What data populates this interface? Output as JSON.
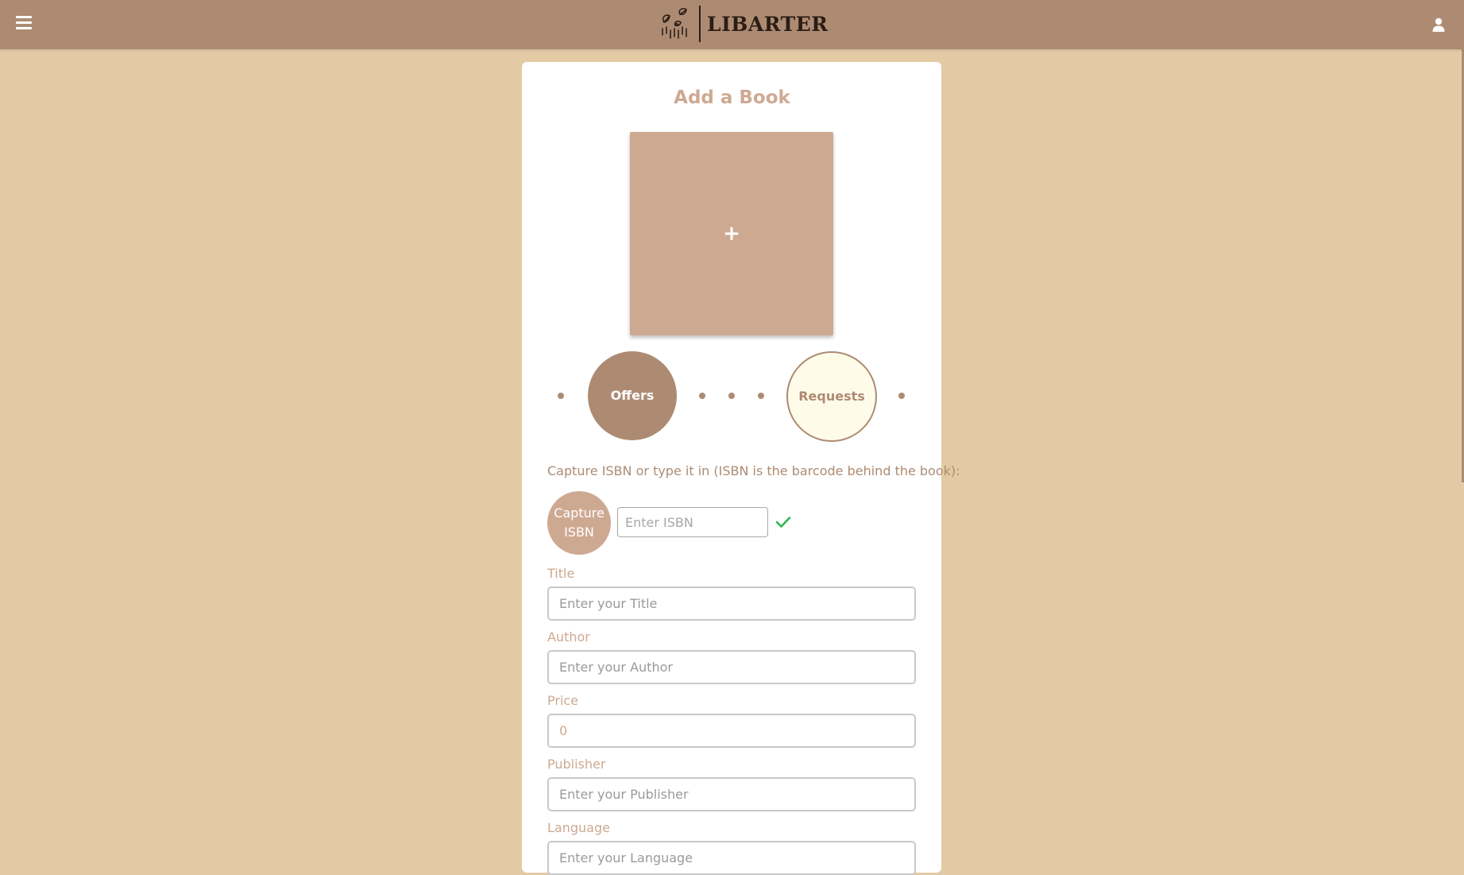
{
  "header": {
    "brand_name": "LIBARTER",
    "menu_icon": "hamburger-menu-icon",
    "user_icon": "user-icon"
  },
  "page": {
    "title": "Add a Book",
    "upload_symbol": "+"
  },
  "mode_toggle": {
    "offers_label": "Offers",
    "requests_label": "Requests",
    "selected": "Offers"
  },
  "isbn": {
    "hint": "Capture ISBN or type it in (ISBN is the barcode behind the book):",
    "capture_label_line1": "Capture",
    "capture_label_line2": "ISBN",
    "placeholder": "Enter ISBN",
    "status_icon": "checkmark-icon"
  },
  "form": {
    "title_label": "Title",
    "title_placeholder": "Enter your Title",
    "author_label": "Author",
    "author_placeholder": "Enter your Author",
    "price_label": "Price",
    "price_placeholder": "0",
    "publisher_label": "Publisher",
    "publisher_placeholder": "Enter your Publisher",
    "language_label": "Language",
    "language_placeholder": "Enter your Language"
  },
  "colors": {
    "page_background": "#e3caa5",
    "header_background": "#ad8b73",
    "accent_light": "#cea992",
    "cream": "#fffbe9",
    "success": "#2fb84a"
  }
}
